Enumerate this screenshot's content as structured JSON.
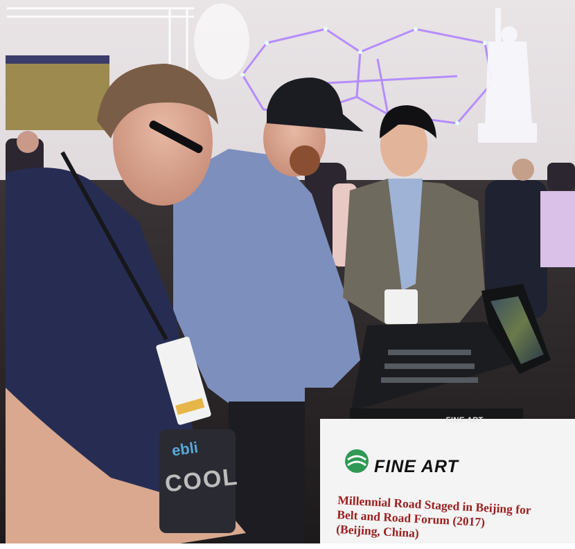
{
  "sign": {
    "brand": "FINE ART",
    "lines": [
      "Millennial Road Staged in Beijing for",
      "Belt and Road Forum (2017)",
      "(Beijing, China)"
    ]
  },
  "console": {
    "brand": "FINE ART"
  },
  "bag": {
    "text_top": "ebli",
    "text_bottom": "COOL"
  },
  "colors": {
    "led_purple": "#b58cff",
    "sign_text": "#9a2020",
    "shirt_navy": "#272d52",
    "shirt_blue": "#7d8fbc",
    "suit_gray": "#6f6a5e",
    "console_black": "#1b1c1f"
  }
}
